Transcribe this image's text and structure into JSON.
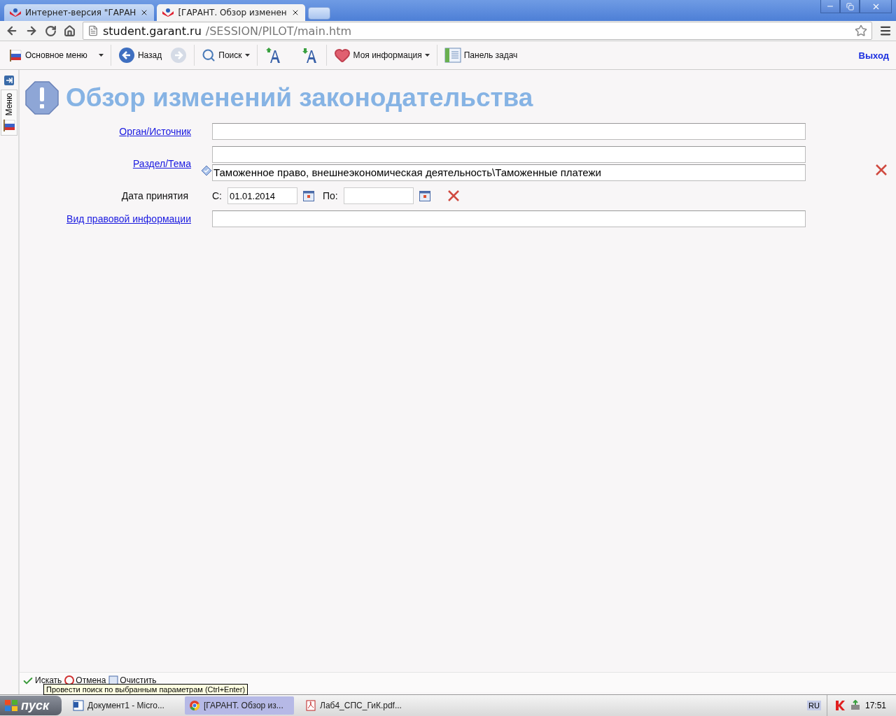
{
  "browser": {
    "tabs": [
      {
        "title": "Интернет-версия \"ГАРАН",
        "selected": false
      },
      {
        "title": "[ГАРАНТ. Обзор изменен",
        "selected": true
      }
    ],
    "address": {
      "host": "student.garant.ru",
      "path": "/SESSION/PILOT/main.htm"
    }
  },
  "toolbar": {
    "main_menu": "Основное меню",
    "back": "Назад",
    "search": "Поиск",
    "my_info": "Моя информация",
    "task_panel": "Панель задач",
    "exit": "Выход"
  },
  "sidebar": {
    "tab": "Меню"
  },
  "page": {
    "title": "Обзор изменений законодательства",
    "fields": [
      {
        "kind": "text",
        "label": "Орган/Источник"
      },
      {
        "kind": "topic",
        "label": "Раздел/Тема",
        "value": "Таможенное право, внешнеэкономическая деятельность\\Таможенные платежи"
      },
      {
        "kind": "date",
        "label": "Дата принятия",
        "from_label": "С:",
        "from": "01.01.2014",
        "to_label": "По:"
      },
      {
        "kind": "text",
        "label": "Вид правовой информации"
      }
    ]
  },
  "actions": [
    {
      "label": "Искать"
    },
    {
      "label": "Отмена"
    },
    {
      "label": "Очистить"
    }
  ],
  "tooltip": "Провести поиск по выбранным параметрам (Ctrl+Enter)",
  "taskbar": {
    "start": "пуск",
    "items": [
      {
        "title": "Документ1 - Micro...",
        "kind": "word",
        "selected": false
      },
      {
        "title": "[ГАРАНТ. Обзор из...",
        "kind": "chrome",
        "selected": true
      },
      {
        "title": "Лаб4_СПС_ГиК.pdf...",
        "kind": "pdf",
        "selected": false
      }
    ],
    "language": "RU",
    "time": "17:51"
  }
}
